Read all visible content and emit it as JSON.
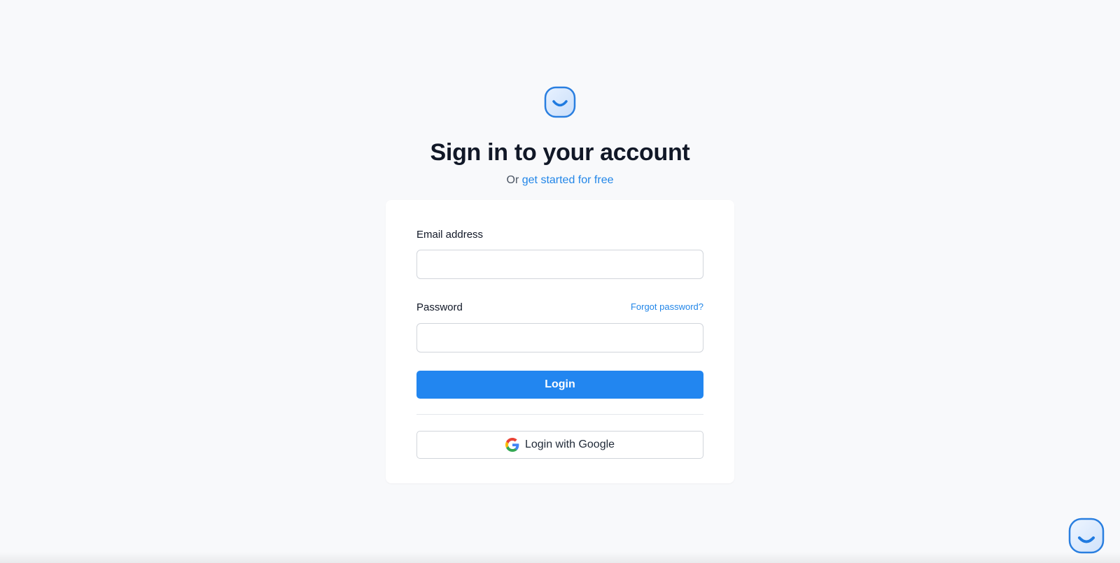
{
  "header": {
    "logo_icon": "smile-logo-icon",
    "title": "Sign in to your account",
    "subtitle_prefix": "Or",
    "signup_link": "get started for free"
  },
  "form": {
    "email_label": "Email address",
    "email_value": "",
    "password_label": "Password",
    "password_value": "",
    "forgot_link": "Forgot password?",
    "login_button": "Login",
    "google_button": "Login with Google",
    "google_icon": "google-g-icon"
  },
  "widget": {
    "icon": "chat-support-icon"
  },
  "colors": {
    "accent": "#2286e8",
    "background": "#f8f9fb",
    "title": "#111827"
  }
}
